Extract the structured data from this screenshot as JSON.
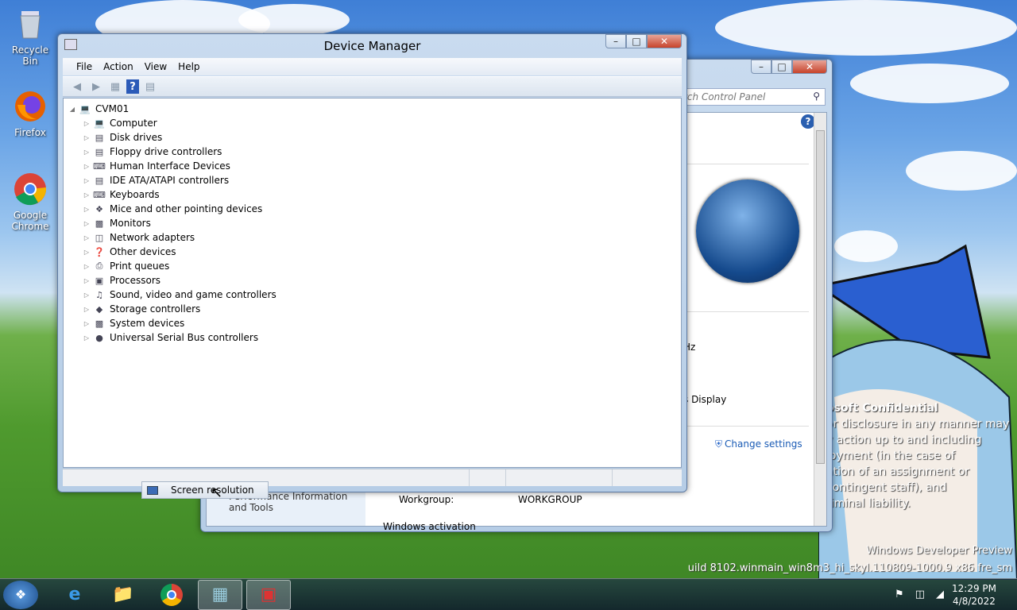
{
  "desktop": {
    "icons": [
      {
        "label": "Recycle Bin"
      },
      {
        "label": "Firefox"
      },
      {
        "label": "Google Chrome"
      }
    ],
    "confidential": {
      "heading": "osoft Confidential",
      "lines": [
        "or disclosure in any manner may",
        "y action up to and including",
        "loyment (in the case of",
        "ation of an assignment or",
        "contingent staff), and",
        "riminal liability."
      ]
    },
    "watermark": {
      "line1": "Windows Developer Preview",
      "line2": "uild 8102.winmain_win8m3_hi_skyl.110809-1000.9 x86 fre_sm"
    }
  },
  "device_manager": {
    "title": "Device Manager",
    "menu": [
      "File",
      "Action",
      "View",
      "Help"
    ],
    "root": "CVM01",
    "nodes": [
      "Computer",
      "Disk drives",
      "Floppy drive controllers",
      "Human Interface Devices",
      "IDE ATA/ATAPI controllers",
      "Keyboards",
      "Mice and other pointing devices",
      "Monitors",
      "Network adapters",
      "Other devices",
      "Print queues",
      "Processors",
      "Sound, video and game controllers",
      "Storage controllers",
      "System devices",
      "Universal Serial Bus controllers"
    ]
  },
  "control_panel": {
    "search_placeholder": "rch Control Panel",
    "hz_text": "Hz",
    "display_text": "s Display",
    "change_settings": "Change settings",
    "perf_info": "Performance Information and Tools",
    "workgroup_label": "Workgroup:",
    "workgroup_value": "WORKGROUP",
    "activation": "Windows activation"
  },
  "jumplist": {
    "item": "Screen resolution"
  },
  "taskbar": {
    "time": "12:29 PM",
    "date": "4/8/2022"
  }
}
